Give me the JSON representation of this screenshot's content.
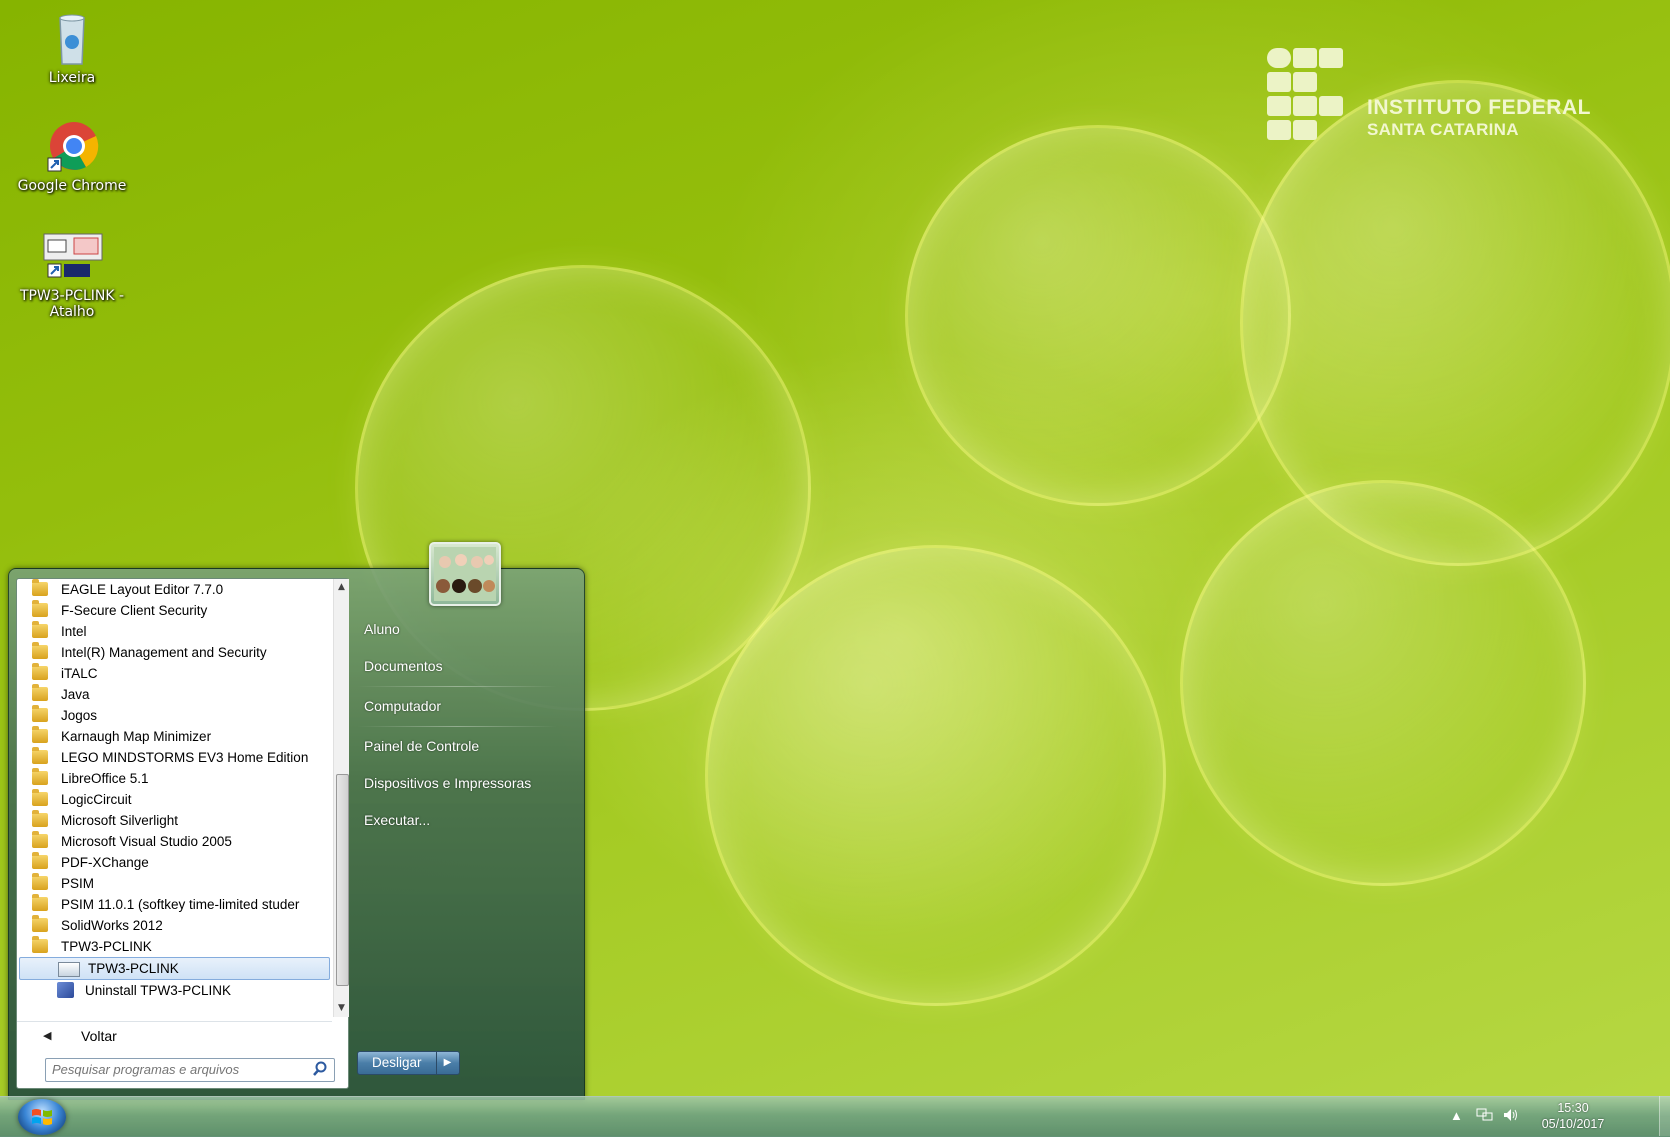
{
  "desktop": {
    "icons": [
      {
        "label": "Lixeira",
        "icon": "recycle-bin-icon"
      },
      {
        "label": "Google Chrome",
        "icon": "chrome-icon"
      },
      {
        "label": "TPW3-PCLINK - Atalho",
        "icon": "tpw3-shortcut-icon"
      }
    ],
    "logo": {
      "line1": "INSTITUTO FEDERAL",
      "line2": "SANTA CATARINA"
    }
  },
  "start_menu": {
    "programs": [
      {
        "label": "EAGLE Layout Editor 7.7.0",
        "type": "folder"
      },
      {
        "label": "F-Secure Client Security",
        "type": "folder"
      },
      {
        "label": "Intel",
        "type": "folder"
      },
      {
        "label": "Intel(R) Management and Security",
        "type": "folder"
      },
      {
        "label": "iTALC",
        "type": "folder"
      },
      {
        "label": "Java",
        "type": "folder"
      },
      {
        "label": "Jogos",
        "type": "folder"
      },
      {
        "label": "Karnaugh Map Minimizer",
        "type": "folder"
      },
      {
        "label": "LEGO MINDSTORMS EV3 Home Edition",
        "type": "folder"
      },
      {
        "label": "LibreOffice 5.1",
        "type": "folder"
      },
      {
        "label": "LogicCircuit",
        "type": "folder"
      },
      {
        "label": "Microsoft Silverlight",
        "type": "folder"
      },
      {
        "label": "Microsoft Visual Studio 2005",
        "type": "folder"
      },
      {
        "label": "PDF-XChange",
        "type": "folder"
      },
      {
        "label": "PSIM",
        "type": "folder"
      },
      {
        "label": "PSIM 11.0.1 (softkey time-limited studer",
        "type": "folder"
      },
      {
        "label": "SolidWorks 2012",
        "type": "folder"
      },
      {
        "label": "TPW3-PCLINK",
        "type": "folder"
      },
      {
        "label": "TPW3-PCLINK",
        "type": "app",
        "selected": true
      },
      {
        "label": "Uninstall TPW3-PCLINK",
        "type": "installer"
      }
    ],
    "back_label": "Voltar",
    "search_placeholder": "Pesquisar programas e arquivos",
    "right_links": [
      "Aluno",
      "Documentos",
      "Computador",
      "Painel de Controle",
      "Dispositivos e Impressoras",
      "Executar..."
    ],
    "shutdown_label": "Desligar"
  },
  "taskbar": {
    "time": "15:30",
    "date": "05/10/2017"
  }
}
